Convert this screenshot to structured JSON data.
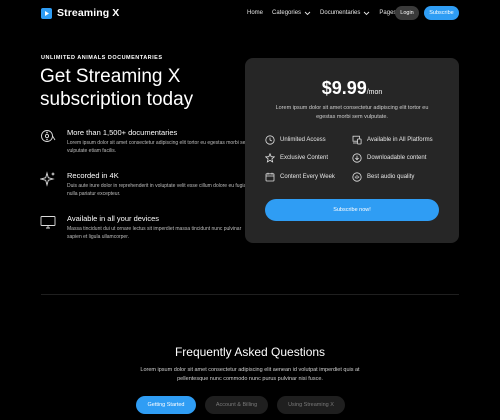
{
  "brand": {
    "name": "Streaming X",
    "accent": "#2f9df4"
  },
  "nav": {
    "links": [
      {
        "label": "Home"
      },
      {
        "label": "Categories"
      },
      {
        "label": "Documentaries"
      },
      {
        "label": "Pages"
      }
    ],
    "login_label": "Login",
    "subscribe_label": "Subscribe"
  },
  "hero": {
    "eyebrow": "UNLIMITED ANIMALS DOCUMENTARIES",
    "title": "Get Streaming X subscription today",
    "features": [
      {
        "icon": "documentary-reel-icon",
        "title": "More than 1,500+ documentaries",
        "text": "Lorem ipsum dolor sit amet consectetur adipiscing elit tortor eu egestas morbi sem vulputate etiam facilis."
      },
      {
        "icon": "sparkle-icon",
        "title": "Recorded in 4K",
        "text": "Duis aute irure dolor in reprehenderit in voluptate velit esse cillum dolore eu fugiat nulla pariatur excepteur."
      },
      {
        "icon": "monitor-icon",
        "title": "Available in all your devices",
        "text": "Massa tincidunt dui ut ornare lectus sit imperdiet massa tincidunt nunc pulvinar sapien et ligula ullamcorper."
      }
    ]
  },
  "plan": {
    "price": "$9.99",
    "period": "/mon",
    "description": "Lorem ipsum dolor sit amet consectetur adipiscing elit tortor eu egestas morbi sem vulputate.",
    "perks": [
      {
        "icon": "clock-icon",
        "label": "Unlimited Access"
      },
      {
        "icon": "devices-icon",
        "label": "Available in All Platforms"
      },
      {
        "icon": "star-icon",
        "label": "Exclusive Content"
      },
      {
        "icon": "download-icon",
        "label": "Downloadable content"
      },
      {
        "icon": "calendar-icon",
        "label": "Content Every Week"
      },
      {
        "icon": "audio-bars-icon",
        "label": "Best audio quality"
      }
    ],
    "cta_label": "Subscribe now!"
  },
  "faq": {
    "title": "Frequently Asked Questions",
    "description": "Lorem ipsum dolor sit amet consectetur adipiscing elit aenean id volutpat imperdiet quis at pellentesque nunc commodo nunc purus pulvinar nisi fusce.",
    "tabs": [
      {
        "label": "Getting Started",
        "active": true
      },
      {
        "label": "Account & Billing",
        "active": false
      },
      {
        "label": "Using Streaming X",
        "active": false
      }
    ]
  }
}
